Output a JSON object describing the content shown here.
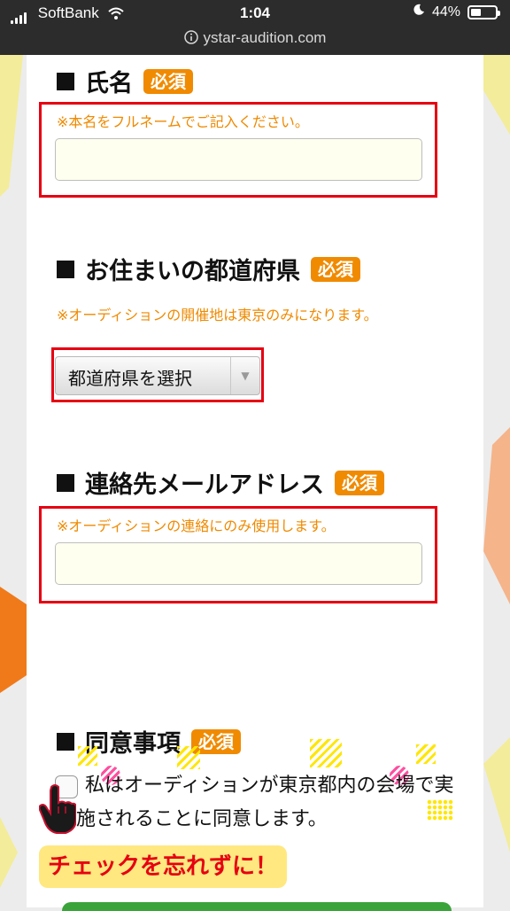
{
  "status_bar": {
    "carrier": "SoftBank",
    "time": "1:04",
    "battery": "44%",
    "battery_level": 0.44
  },
  "browser": {
    "url": "ystar-audition.com"
  },
  "form": {
    "name_section": {
      "title": "氏名",
      "required": "必須",
      "note": "※本名をフルネームでご記入ください。",
      "value": ""
    },
    "prefecture_section": {
      "title": "お住まいの都道府県",
      "required": "必須",
      "note": "※オーディションの開催地は東京のみになります。",
      "selected": "都道府県を選択"
    },
    "email_section": {
      "title": "連絡先メールアドレス",
      "required": "必須",
      "note": "※オーディションの連絡にのみ使用します。",
      "value": ""
    },
    "consent_section": {
      "title": "同意事項",
      "required": "必須",
      "agreement_text": "私はオーディションが東京都内の会場で実施されることに同意します。",
      "checked": false,
      "reminder": "チェックを忘れずに！"
    }
  },
  "colors": {
    "accent_orange": "#f08a00",
    "error_red": "#e60012",
    "highlight_yellow": "#ffe880"
  },
  "icons": {
    "site_info": "info-circle-icon",
    "pointer": "pointing-hand-icon"
  }
}
